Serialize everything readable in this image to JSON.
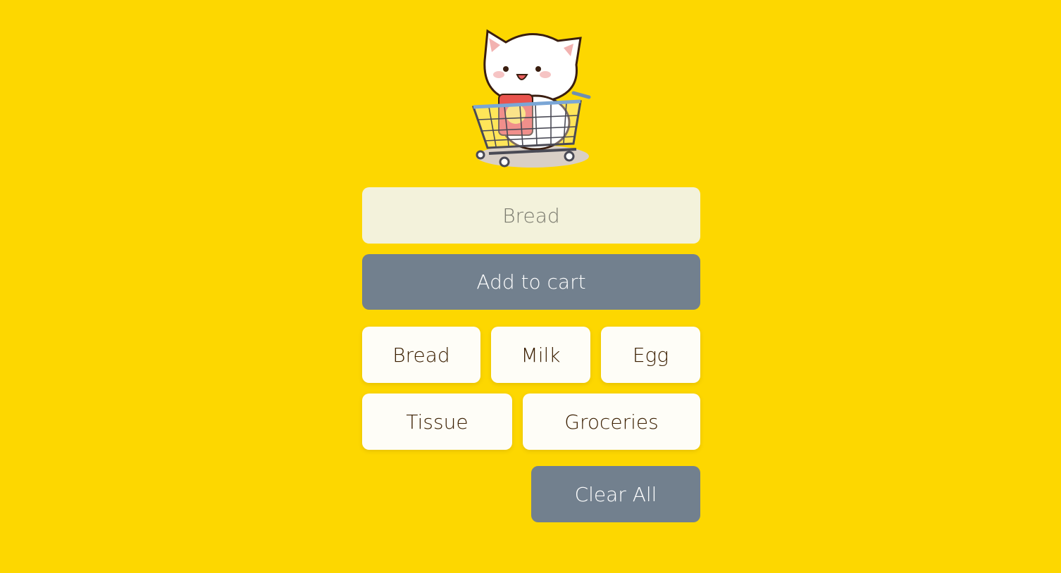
{
  "mascot": {
    "icon": "cat-in-shopping-cart-icon"
  },
  "entry": {
    "placeholder": "Bread"
  },
  "actions": {
    "add_label": "Add to cart",
    "clear_label": "Clear All"
  },
  "cart": {
    "items": [
      {
        "label": "Bread"
      },
      {
        "label": "Milk"
      },
      {
        "label": "Egg"
      },
      {
        "label": "Tissue"
      },
      {
        "label": "Groceries"
      }
    ]
  },
  "colors": {
    "background": "#FDD700",
    "input_bg": "#F3F2DB",
    "button_bg": "#72808E",
    "chip_bg": "#FEFDF7",
    "chip_text": "#3A1E00"
  }
}
